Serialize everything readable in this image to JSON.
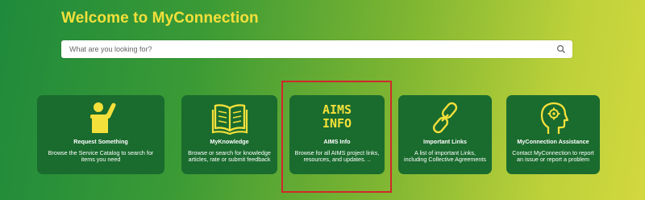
{
  "header": {
    "title": "Welcome to MyConnection"
  },
  "search": {
    "placeholder": "What are you looking for?"
  },
  "cards": [
    {
      "title": "Request Something",
      "description": "Browse the Service Catalog to search for items you need",
      "icon": "person-raising-hand-icon"
    },
    {
      "title": "MyKnowledge",
      "description": "Browse or search for knowledge articles, rate or submit feedback",
      "icon": "open-book-icon"
    },
    {
      "title": "AIMS Info",
      "description": "Browse for all AIMS project links, resources, and updates. ..",
      "icon_text_line1": "AIMS",
      "icon_text_line2": "INFO"
    },
    {
      "title": "Important Links",
      "description": "A list of important Links, including Collective Agreements",
      "icon": "chain-link-icon"
    },
    {
      "title": "MyConnection Assistance",
      "description": "Contact MyConnection to report an issue or report a problem",
      "icon": "head-gear-icon"
    }
  ],
  "colors": {
    "accent": "#f4e03a",
    "card_bg": "#1a6b2e",
    "highlight": "#d0282a"
  }
}
